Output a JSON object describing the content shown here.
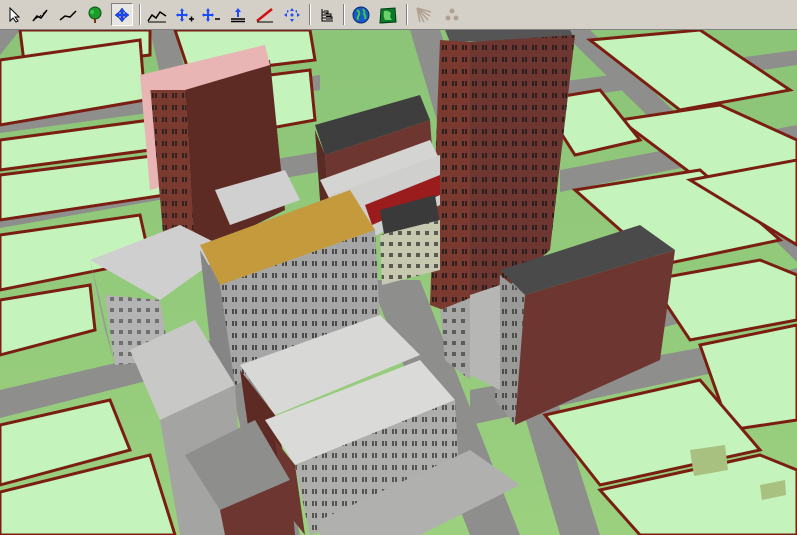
{
  "window": {
    "title": ""
  },
  "toolbar": {
    "tools": [
      {
        "icon": "select-arrow-icon"
      },
      {
        "icon": "draw-polygon-icon"
      },
      {
        "icon": "draw-line-icon"
      },
      {
        "icon": "add-tree-icon"
      },
      {
        "icon": "move-icon"
      },
      {
        "icon": "terrain-profile-icon"
      },
      {
        "icon": "zoom-in-icon"
      },
      {
        "icon": "zoom-out-icon"
      },
      {
        "icon": "elevation-icon"
      },
      {
        "icon": "measure-slope-icon"
      },
      {
        "icon": "pan-arrows-icon"
      },
      {
        "icon": "layers-icon"
      },
      {
        "icon": "globe-icon"
      },
      {
        "icon": "map-icon"
      },
      {
        "icon": "sun-rays-icon"
      },
      {
        "icon": "points-icon"
      }
    ],
    "active_tool": "move-icon"
  },
  "scene": {
    "type": "3d-city-view",
    "colors": {
      "ground": "#98d07c",
      "block_top": "#c4f4bc",
      "block_edge": "#8a2418",
      "road": "#8e8e8c",
      "tower_wall": "#6e3630",
      "tower_wall_light": "#8a4a40",
      "roof_gray": "#d4d4d2",
      "roof_orange": "#c49a3c",
      "roof_pink": "#e8b4b4",
      "roof_dark": "#4a4a4a"
    }
  }
}
